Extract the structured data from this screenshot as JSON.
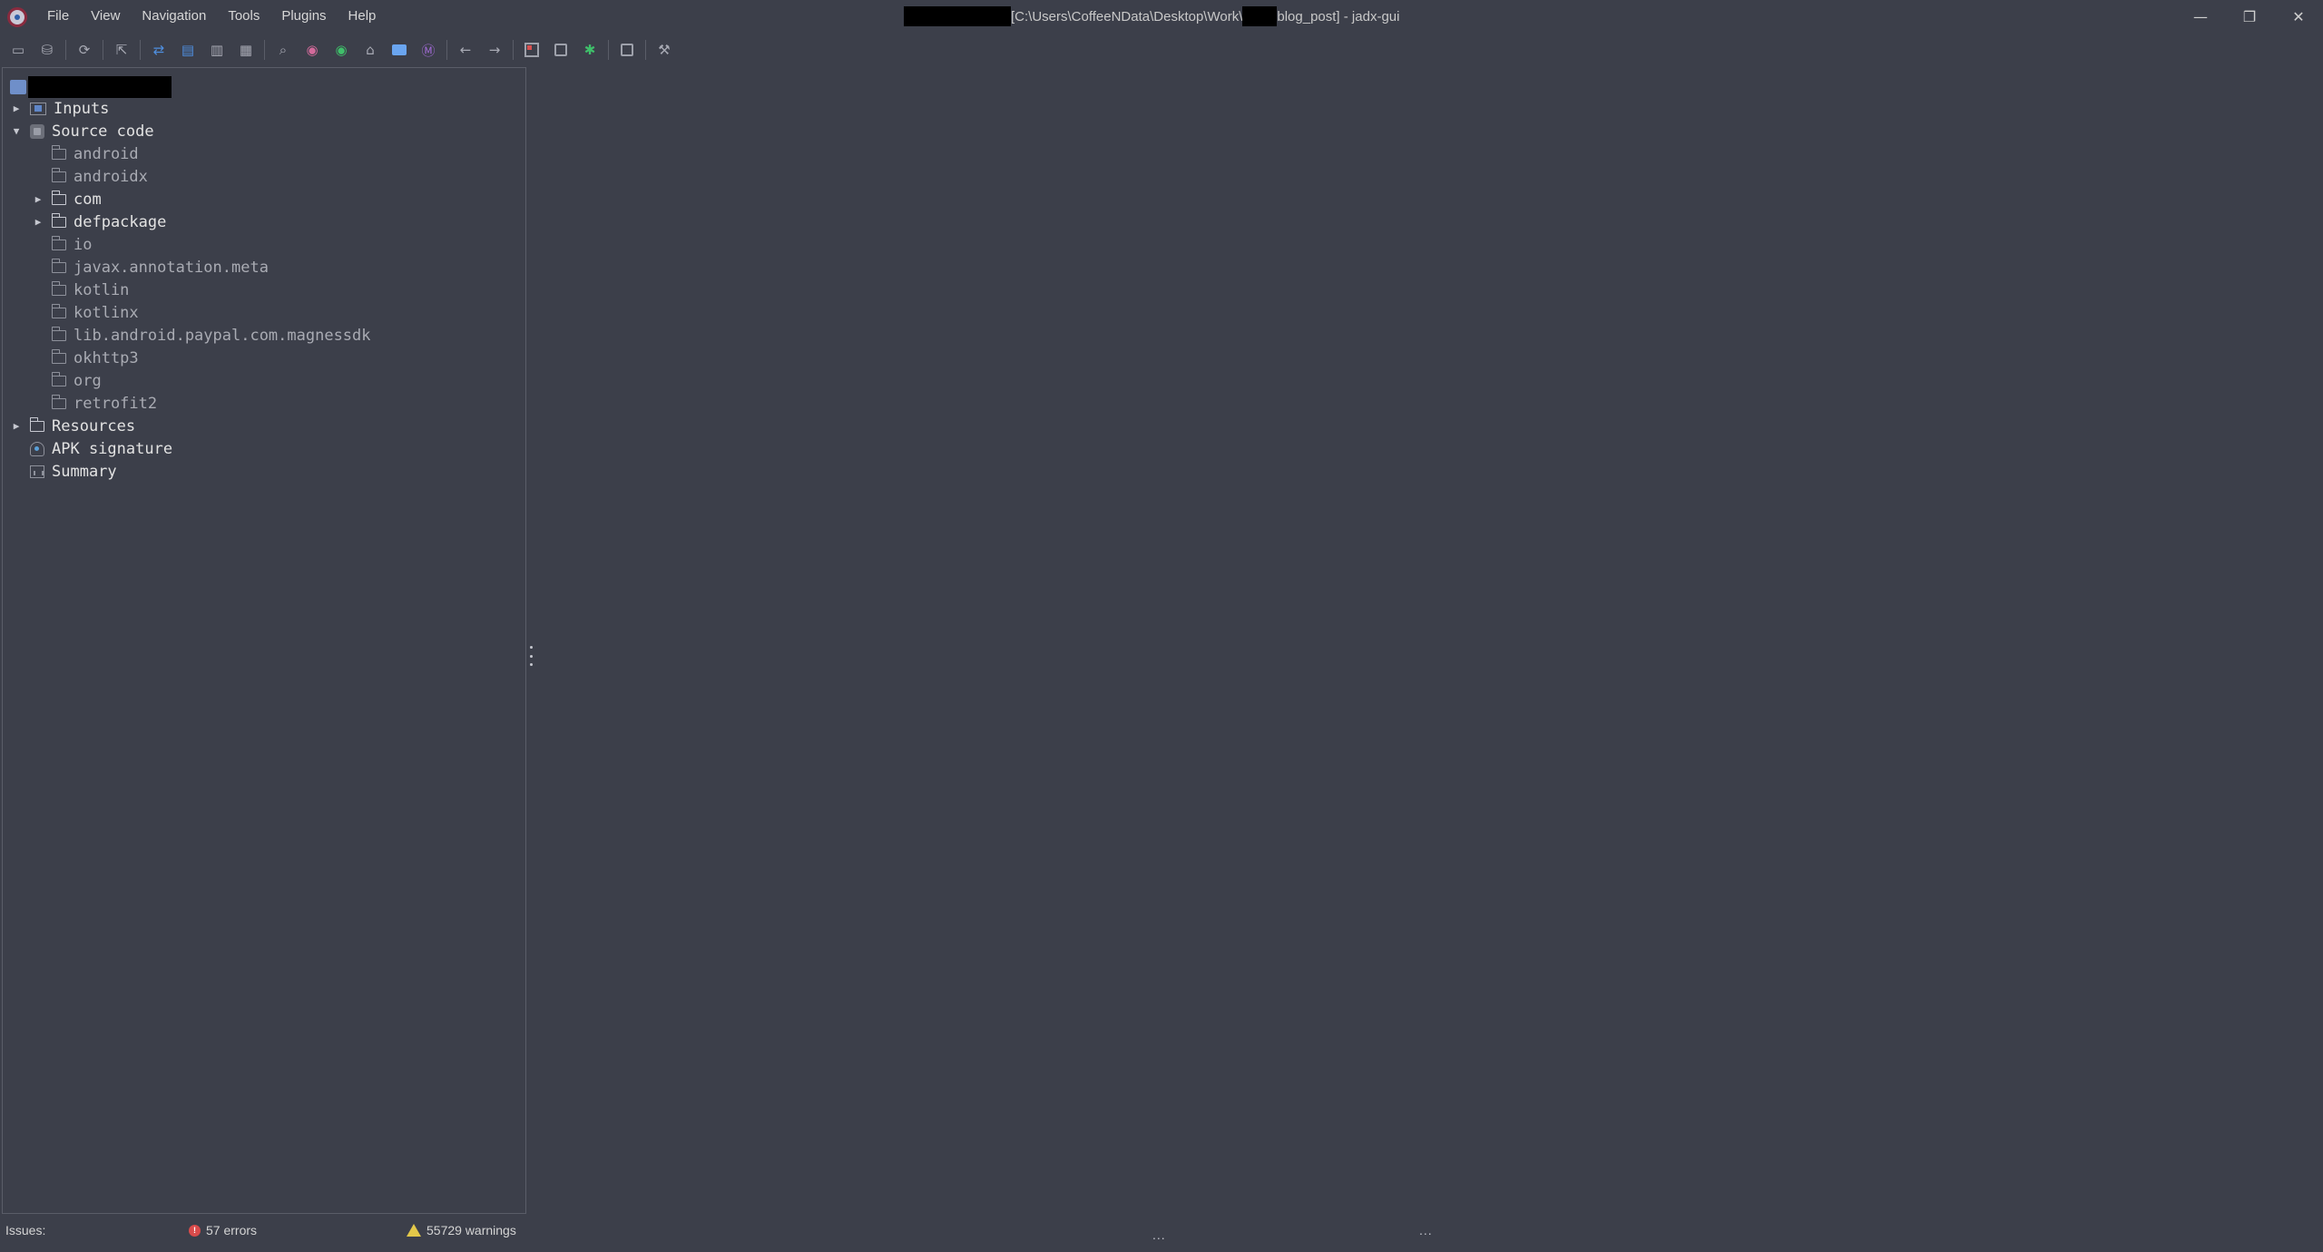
{
  "window": {
    "title_path": "[C:\\Users\\CoffeeNData\\Desktop\\Work\\",
    "title_suffix": "blog_post] - jadx-gui",
    "controls": {
      "minimize": "—",
      "restore": "❐",
      "close": "✕"
    }
  },
  "menu": [
    "File",
    "View",
    "Navigation",
    "Tools",
    "Plugins",
    "Help"
  ],
  "toolbar": {
    "icons": [
      "open-file-icon",
      "save-all-icon",
      "reload-icon",
      "export-icon",
      "sync-with-editor-icon",
      "flatten-packages-icon",
      "hide-sidebar-icon",
      "code-area-icon",
      "search-text-icon",
      "find-class-icon",
      "find-usage-icon",
      "go-home-icon",
      "log-viewer-icon",
      "smali-icon",
      "back-arrow-icon",
      "forward-arrow-icon",
      "deobfuscation-icon",
      "decompile-all-icon",
      "debugger-icon",
      "quark-icon",
      "preferences-icon"
    ]
  },
  "tree": {
    "root_redacted": true,
    "items": [
      {
        "label": "Inputs",
        "expanded": false
      },
      {
        "label": "Source code",
        "expanded": true
      },
      {
        "label": "android"
      },
      {
        "label": "androidx"
      },
      {
        "label": "com",
        "expanded": false
      },
      {
        "label": "defpackage",
        "expanded": false
      },
      {
        "label": "io"
      },
      {
        "label": "javax.annotation.meta"
      },
      {
        "label": "kotlin"
      },
      {
        "label": "kotlinx"
      },
      {
        "label": "lib.android.paypal.com.magnessdk"
      },
      {
        "label": "okhttp3"
      },
      {
        "label": "org"
      },
      {
        "label": "retrofit2"
      },
      {
        "label": "Resources",
        "expanded": false
      },
      {
        "label": "APK signature"
      },
      {
        "label": "Summary"
      }
    ]
  },
  "status": {
    "issues_label": "Issues:",
    "errors": "57 errors",
    "warnings": "55729 warnings"
  }
}
